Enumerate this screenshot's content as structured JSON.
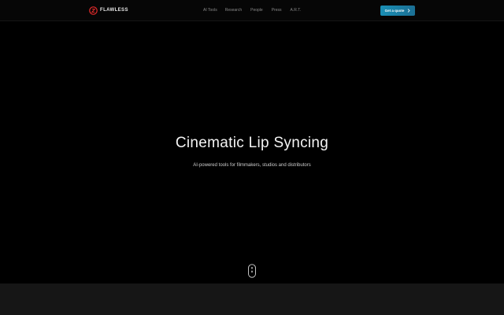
{
  "brand": {
    "name": "FLAWLESS",
    "accent_color": "#e02a2a"
  },
  "nav": {
    "items": [
      {
        "label": "AI Tools"
      },
      {
        "label": "Research"
      },
      {
        "label": "People"
      },
      {
        "label": "Press"
      },
      {
        "label": "A.R.T."
      }
    ]
  },
  "cta": {
    "label": "Get a quote",
    "icon": "chevron-right-icon",
    "color": "#1a8fb5"
  },
  "hero": {
    "title": "Cinematic Lip Syncing",
    "subtitle": "AI-powered tools for filmmakers, studios and distributors",
    "scroll_icon": "mouse-scroll-icon"
  }
}
